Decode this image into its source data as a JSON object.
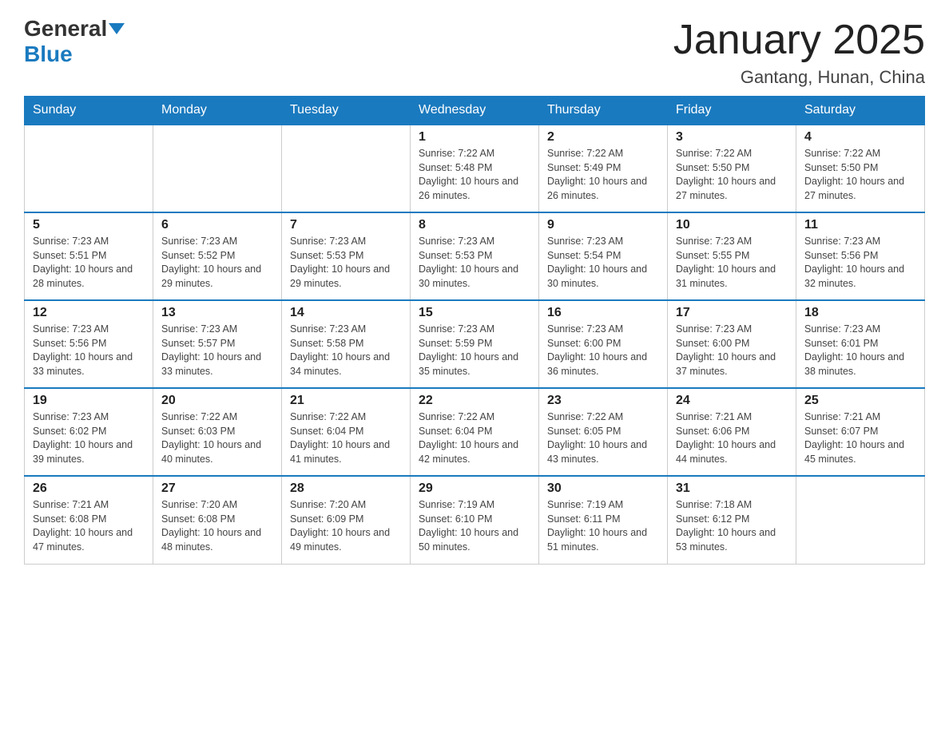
{
  "header": {
    "logo": {
      "general": "General",
      "blue": "Blue"
    },
    "title": "January 2025",
    "location": "Gantang, Hunan, China"
  },
  "days_of_week": [
    "Sunday",
    "Monday",
    "Tuesday",
    "Wednesday",
    "Thursday",
    "Friday",
    "Saturday"
  ],
  "weeks": [
    [
      {
        "day": "",
        "info": ""
      },
      {
        "day": "",
        "info": ""
      },
      {
        "day": "",
        "info": ""
      },
      {
        "day": "1",
        "info": "Sunrise: 7:22 AM\nSunset: 5:48 PM\nDaylight: 10 hours and 26 minutes."
      },
      {
        "day": "2",
        "info": "Sunrise: 7:22 AM\nSunset: 5:49 PM\nDaylight: 10 hours and 26 minutes."
      },
      {
        "day": "3",
        "info": "Sunrise: 7:22 AM\nSunset: 5:50 PM\nDaylight: 10 hours and 27 minutes."
      },
      {
        "day": "4",
        "info": "Sunrise: 7:22 AM\nSunset: 5:50 PM\nDaylight: 10 hours and 27 minutes."
      }
    ],
    [
      {
        "day": "5",
        "info": "Sunrise: 7:23 AM\nSunset: 5:51 PM\nDaylight: 10 hours and 28 minutes."
      },
      {
        "day": "6",
        "info": "Sunrise: 7:23 AM\nSunset: 5:52 PM\nDaylight: 10 hours and 29 minutes."
      },
      {
        "day": "7",
        "info": "Sunrise: 7:23 AM\nSunset: 5:53 PM\nDaylight: 10 hours and 29 minutes."
      },
      {
        "day": "8",
        "info": "Sunrise: 7:23 AM\nSunset: 5:53 PM\nDaylight: 10 hours and 30 minutes."
      },
      {
        "day": "9",
        "info": "Sunrise: 7:23 AM\nSunset: 5:54 PM\nDaylight: 10 hours and 30 minutes."
      },
      {
        "day": "10",
        "info": "Sunrise: 7:23 AM\nSunset: 5:55 PM\nDaylight: 10 hours and 31 minutes."
      },
      {
        "day": "11",
        "info": "Sunrise: 7:23 AM\nSunset: 5:56 PM\nDaylight: 10 hours and 32 minutes."
      }
    ],
    [
      {
        "day": "12",
        "info": "Sunrise: 7:23 AM\nSunset: 5:56 PM\nDaylight: 10 hours and 33 minutes."
      },
      {
        "day": "13",
        "info": "Sunrise: 7:23 AM\nSunset: 5:57 PM\nDaylight: 10 hours and 33 minutes."
      },
      {
        "day": "14",
        "info": "Sunrise: 7:23 AM\nSunset: 5:58 PM\nDaylight: 10 hours and 34 minutes."
      },
      {
        "day": "15",
        "info": "Sunrise: 7:23 AM\nSunset: 5:59 PM\nDaylight: 10 hours and 35 minutes."
      },
      {
        "day": "16",
        "info": "Sunrise: 7:23 AM\nSunset: 6:00 PM\nDaylight: 10 hours and 36 minutes."
      },
      {
        "day": "17",
        "info": "Sunrise: 7:23 AM\nSunset: 6:00 PM\nDaylight: 10 hours and 37 minutes."
      },
      {
        "day": "18",
        "info": "Sunrise: 7:23 AM\nSunset: 6:01 PM\nDaylight: 10 hours and 38 minutes."
      }
    ],
    [
      {
        "day": "19",
        "info": "Sunrise: 7:23 AM\nSunset: 6:02 PM\nDaylight: 10 hours and 39 minutes."
      },
      {
        "day": "20",
        "info": "Sunrise: 7:22 AM\nSunset: 6:03 PM\nDaylight: 10 hours and 40 minutes."
      },
      {
        "day": "21",
        "info": "Sunrise: 7:22 AM\nSunset: 6:04 PM\nDaylight: 10 hours and 41 minutes."
      },
      {
        "day": "22",
        "info": "Sunrise: 7:22 AM\nSunset: 6:04 PM\nDaylight: 10 hours and 42 minutes."
      },
      {
        "day": "23",
        "info": "Sunrise: 7:22 AM\nSunset: 6:05 PM\nDaylight: 10 hours and 43 minutes."
      },
      {
        "day": "24",
        "info": "Sunrise: 7:21 AM\nSunset: 6:06 PM\nDaylight: 10 hours and 44 minutes."
      },
      {
        "day": "25",
        "info": "Sunrise: 7:21 AM\nSunset: 6:07 PM\nDaylight: 10 hours and 45 minutes."
      }
    ],
    [
      {
        "day": "26",
        "info": "Sunrise: 7:21 AM\nSunset: 6:08 PM\nDaylight: 10 hours and 47 minutes."
      },
      {
        "day": "27",
        "info": "Sunrise: 7:20 AM\nSunset: 6:08 PM\nDaylight: 10 hours and 48 minutes."
      },
      {
        "day": "28",
        "info": "Sunrise: 7:20 AM\nSunset: 6:09 PM\nDaylight: 10 hours and 49 minutes."
      },
      {
        "day": "29",
        "info": "Sunrise: 7:19 AM\nSunset: 6:10 PM\nDaylight: 10 hours and 50 minutes."
      },
      {
        "day": "30",
        "info": "Sunrise: 7:19 AM\nSunset: 6:11 PM\nDaylight: 10 hours and 51 minutes."
      },
      {
        "day": "31",
        "info": "Sunrise: 7:18 AM\nSunset: 6:12 PM\nDaylight: 10 hours and 53 minutes."
      },
      {
        "day": "",
        "info": ""
      }
    ]
  ]
}
